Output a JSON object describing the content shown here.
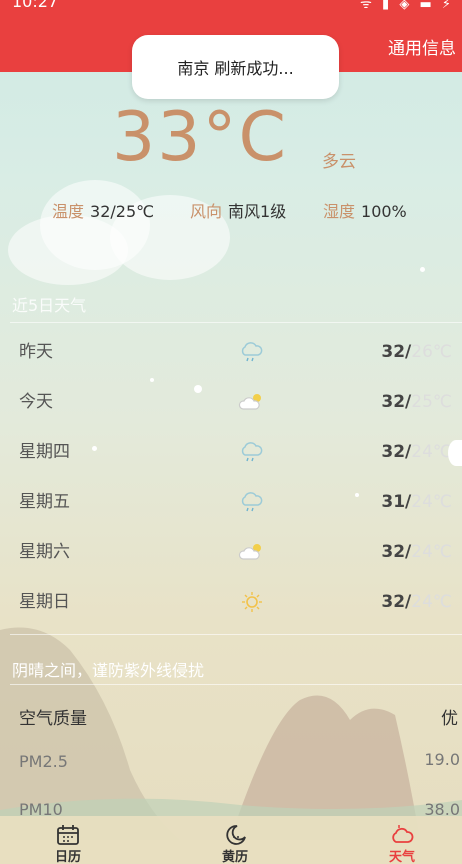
{
  "status_bar": {
    "time": "10:27",
    "icons": "ᯤ ▮ ◈ ▬ ⚡"
  },
  "header": {
    "right_link": "通用信息"
  },
  "toast": {
    "text": "南京 刷新成功..."
  },
  "current": {
    "temperature": "33°C",
    "description": "多云",
    "temp_range_label": "温度",
    "temp_range_value": "32/25℃",
    "wind_label": "风向",
    "wind_value": "南风1级",
    "humidity_label": "湿度",
    "humidity_value": "100%"
  },
  "forecast": {
    "title": "近5日天气",
    "days": [
      {
        "name": "昨天",
        "icon": "rain-cloud-icon",
        "high": "32/",
        "low": "26℃"
      },
      {
        "name": "今天",
        "icon": "sun-cloud-icon",
        "high": "32/",
        "low": "25℃"
      },
      {
        "name": "星期四",
        "icon": "rain-cloud-icon",
        "high": "32/",
        "low": "24℃"
      },
      {
        "name": "星期五",
        "icon": "rain-cloud-icon",
        "high": "31/",
        "low": "24℃"
      },
      {
        "name": "星期六",
        "icon": "sun-cloud-icon",
        "high": "32/",
        "low": "24℃"
      },
      {
        "name": "星期日",
        "icon": "sun-icon",
        "high": "32/",
        "low": "24℃"
      }
    ]
  },
  "tip": "阴晴之间，谨防紫外线侵扰",
  "air_quality": {
    "title": "空气质量",
    "grade": "优",
    "items": [
      {
        "label": "PM2.5",
        "value": "19.0"
      },
      {
        "label": "PM10",
        "value": "38.0"
      }
    ]
  },
  "tabs": [
    {
      "label": "日历",
      "icon": "calendar-icon"
    },
    {
      "label": "黄历",
      "icon": "moon-icon"
    },
    {
      "label": "天气",
      "icon": "cloud-icon",
      "active": true
    }
  ],
  "colors": {
    "accent": "#e9403f",
    "temp": "#c9916a"
  }
}
